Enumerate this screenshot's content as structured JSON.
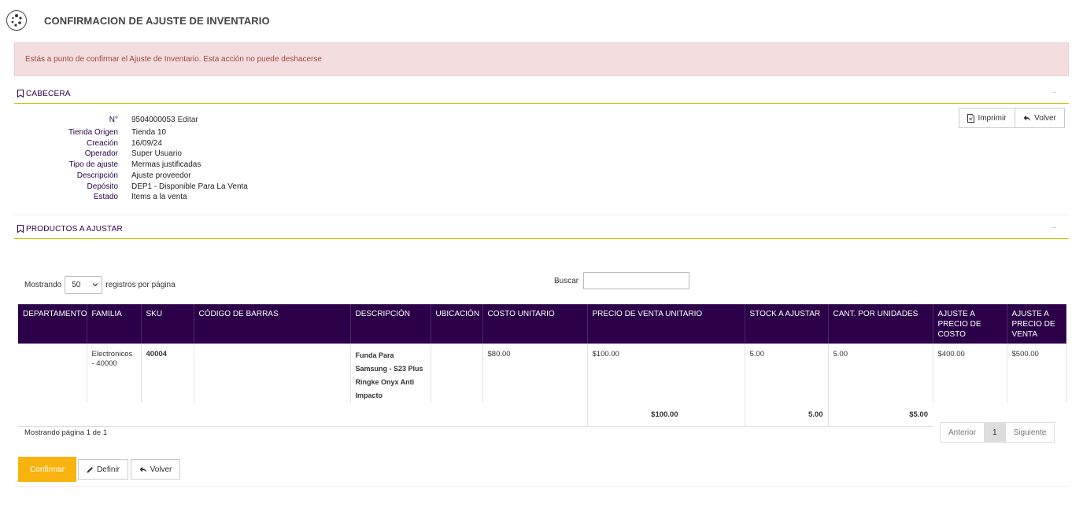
{
  "header": {
    "title": "CONFIRMACION DE AJUSTE DE INVENTARIO",
    "logo_icon": "spinner-logo-icon"
  },
  "alert": {
    "text": "Estás a punto de confirmar el Ajuste de Inventario. Esta acción no puede deshacerse"
  },
  "cabecera": {
    "title": "CABECERA",
    "collapse": "–",
    "fields": [
      {
        "key": "N°",
        "value": "9504000053"
      },
      {
        "key": "Tienda Origen",
        "value": "Tienda 10"
      },
      {
        "key": "Creación",
        "value": "16/09/24"
      },
      {
        "key": "Operador",
        "value": "Super Usuario"
      },
      {
        "key": "Tipo de ajuste",
        "value": "Mermas justificadas"
      },
      {
        "key": "Descripción",
        "value": "Ajuste proveedor"
      },
      {
        "key": "Depósito",
        "value": "DEP1 - Disponible Para La Venta"
      },
      {
        "key": "Estado",
        "value": "Items a la venta"
      }
    ],
    "edit_link": "Editar",
    "print_button": "Imprimir",
    "back_button": "Volver"
  },
  "productos": {
    "title": "PRODUCTOS A AJUSTAR",
    "collapse": "–",
    "show_prefix": "Mostrando",
    "page_size": "50",
    "show_suffix": "registros por página",
    "search_label": "Buscar",
    "columns": [
      "DEPARTAMENTO",
      "FAMILIA",
      "SKU",
      "CÓDIGO DE BARRAS",
      "DESCRIPCIÓN",
      "UBICACIÓN",
      "COSTO UNITARIO",
      "PRECIO DE VENTA UNITARIO",
      "STOCK A AJUSTAR",
      "CANT. POR UNIDADES",
      "AJUSTE A PRECIO DE COSTO",
      "AJUSTE A PRECIO DE VENTA"
    ],
    "rows": [
      {
        "departamento": "",
        "familia": "Electronicos - 40000",
        "sku": "40004",
        "codigo_barras": "",
        "descripcion": "Funda Para Samsung - S23 Plus Ringke Onyx Anti Impacto",
        "ubicacion": "",
        "costo_unitario": "$80.00",
        "precio_venta": "$100.00",
        "stock_ajustar": "5.00",
        "cant_unidades": "5.00",
        "ajuste_costo": "$400.00",
        "ajuste_venta": "$500.00"
      }
    ],
    "totals": {
      "precio_venta": "$100.00",
      "stock_ajustar": "5.00",
      "cant_unidades": "$5.00"
    },
    "page_info": "Mostrando página 1 de 1",
    "pager": {
      "prev": "Anterior",
      "current": "1",
      "next": "Siguiente"
    }
  },
  "footer": {
    "confirm": "Confirmar",
    "define": "Definir",
    "back": "Volver"
  },
  "colors": {
    "primary": "#2b0048",
    "accent": "#f9b30f",
    "alert_bg": "#f2dede",
    "alert_text": "#a94442",
    "section_line": "#c8c800"
  }
}
